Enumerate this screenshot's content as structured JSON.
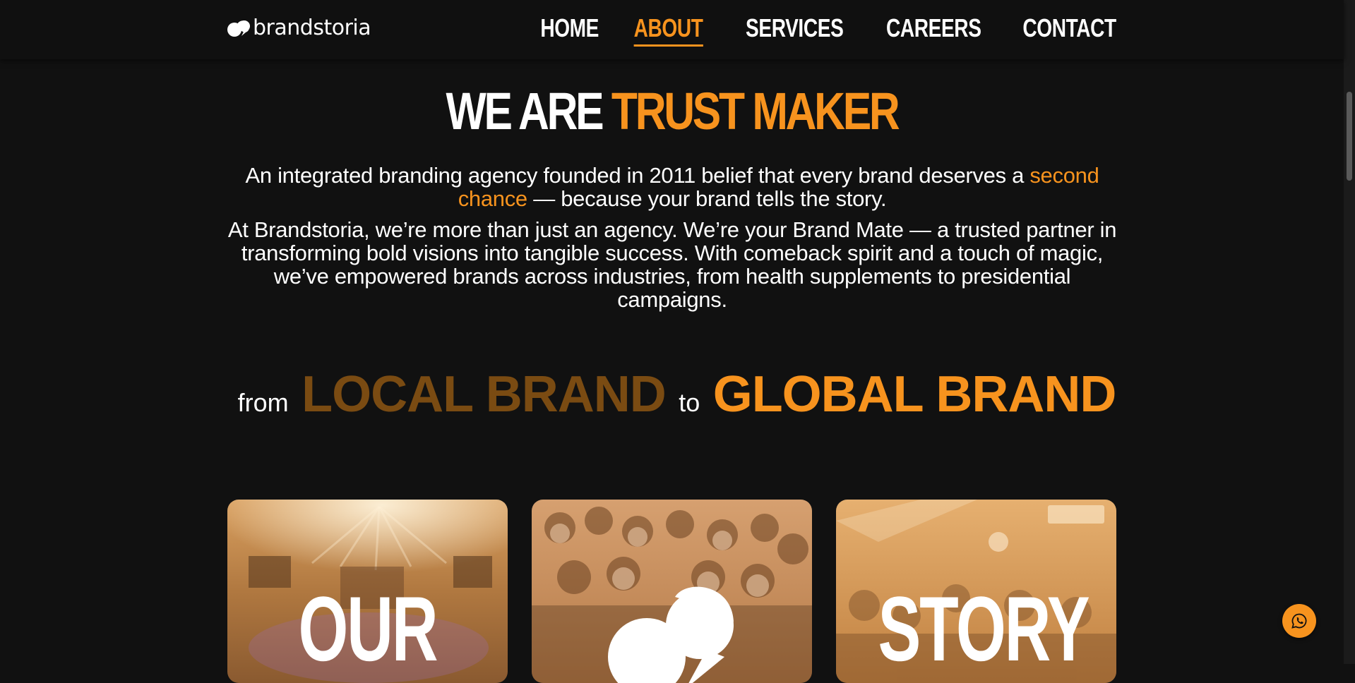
{
  "brand": {
    "name": "brandstoria"
  },
  "nav": {
    "items": [
      {
        "label": "HOME",
        "active": false
      },
      {
        "label": "ABOUT",
        "active": true
      },
      {
        "label": "SERVICES",
        "active": false
      },
      {
        "label": "CAREERS",
        "active": false
      },
      {
        "label": "CONTACT",
        "active": false
      }
    ]
  },
  "hero": {
    "title_plain": "WE ARE",
    "title_accent": "TRUST MAKER",
    "intro_1_before": "An integrated branding agency founded in 2011 belief that every brand deserves a",
    "intro_1_accent": "second chance",
    "intro_1_after": "— because your brand tells the story.",
    "intro_2": "At Brandstoria, we’re more than just an agency. We’re your Brand Mate — a trusted partner in transforming bold visions into tangible success. With comeback spirit and a touch of magic, we’ve empowered brands across industries, from health supplements to presidential campaigns."
  },
  "tagline": {
    "from": "from",
    "local": "LOCAL BRAND",
    "to": "to",
    "global": "GLOBAL BRAND"
  },
  "cards": {
    "left_word": "OUR",
    "right_word": "STORY"
  },
  "icons": {
    "logo": "brandstoria-logo-icon",
    "chat": "whatsapp-icon"
  },
  "colors": {
    "accent": "#f7931e",
    "accent_dark": "#7a4b12",
    "background": "#111111"
  }
}
